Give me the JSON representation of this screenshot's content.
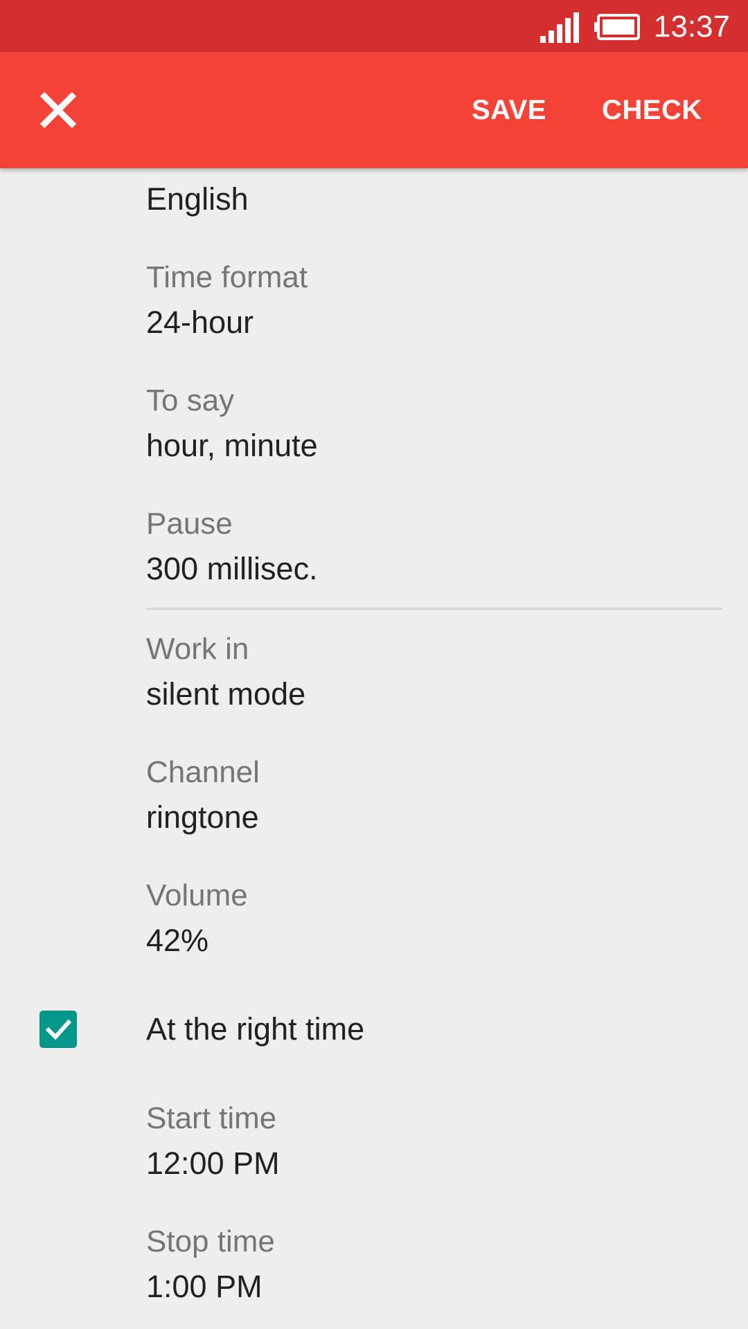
{
  "status_bar": {
    "time": "13:37",
    "icons": [
      "signal-icon",
      "battery-icon"
    ],
    "color": "#d32f2f"
  },
  "app_bar": {
    "close_icon": "close-icon",
    "save_label": "SAVE",
    "check_label": "CHECK",
    "color": "#f44336"
  },
  "settings": {
    "language": {
      "value": "English"
    },
    "time_format": {
      "label": "Time format",
      "value": "24-hour"
    },
    "to_say": {
      "label": "To say",
      "value": "hour, minute"
    },
    "pause": {
      "label": "Pause",
      "value": "300 millisec."
    },
    "work_in": {
      "label": "Work in",
      "value": "silent mode"
    },
    "channel": {
      "label": "Channel",
      "value": "ringtone"
    },
    "volume": {
      "label": "Volume",
      "value": "42%"
    },
    "at_right_time": {
      "label": "At the right time",
      "checked": true,
      "check_color": "#009688"
    },
    "start_time": {
      "label": "Start time",
      "value": "12:00 PM"
    },
    "stop_time": {
      "label": "Stop time",
      "value": "1:00 PM"
    }
  }
}
